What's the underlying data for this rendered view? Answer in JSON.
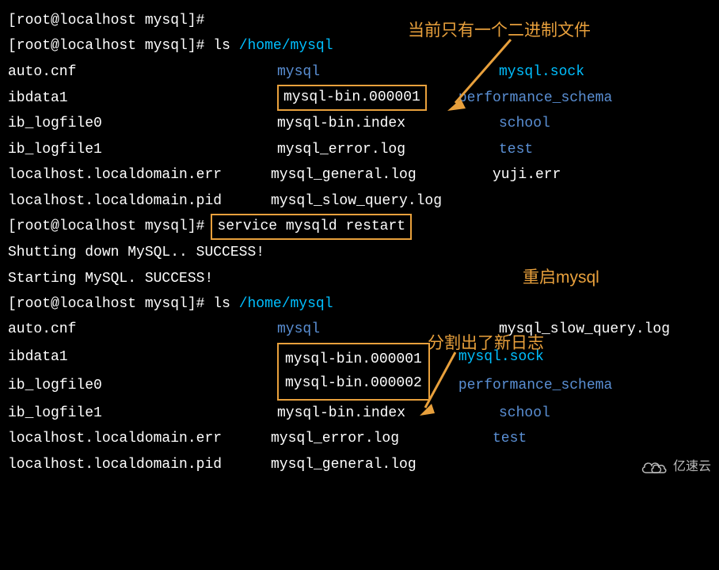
{
  "prompt": "[root@localhost mysql]#",
  "cmd_ls": "ls",
  "path_home_mysql": "/home/mysql",
  "listing1": {
    "col1": [
      "auto.cnf",
      "ibdata1",
      "ib_logfile0",
      "ib_logfile1",
      "localhost.localdomain.err",
      "localhost.localdomain.pid"
    ],
    "col2": [
      "mysql",
      "mysql-bin.000001",
      "mysql-bin.index",
      "mysql_error.log",
      "mysql_general.log",
      "mysql_slow_query.log"
    ],
    "col3": [
      "mysql.sock",
      "performance_schema",
      "school",
      "test",
      "yuji.err",
      ""
    ]
  },
  "cmd_restart": "service mysqld restart",
  "shutdown_msg": "Shutting down MySQL.. SUCCESS!",
  "starting_msg": "Starting MySQL. SUCCESS!",
  "listing2": {
    "col1": [
      "auto.cnf",
      "ibdata1",
      "ib_logfile0",
      "ib_logfile1",
      "localhost.localdomain.err",
      "localhost.localdomain.pid"
    ],
    "col2": [
      "mysql",
      "mysql-bin.000001",
      "mysql-bin.000002",
      "mysql-bin.index",
      "mysql_error.log",
      "mysql_general.log"
    ],
    "col3": [
      "mysql_slow_query.log",
      "mysql.sock",
      "performance_schema",
      "school",
      "test",
      ""
    ]
  },
  "anno_top": "当前只有一个二进制文件",
  "anno_mid": "重启mysql",
  "anno_bot": "分割出了新日志",
  "watermark_text": "亿速云"
}
